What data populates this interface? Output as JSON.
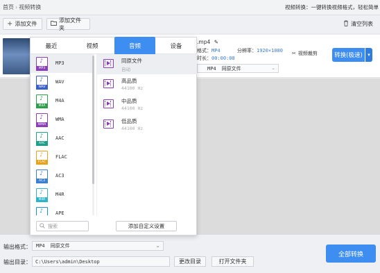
{
  "topbar": {
    "breadcrumb_home": "首页",
    "breadcrumb_sep": "›",
    "breadcrumb_current": "视频转换",
    "tagline": "视频转换：一键转换视频格式，轻松简单"
  },
  "toolbar": {
    "add_file": "添加文件",
    "add_folder": "添加文件夹",
    "clear_list": "清空列表"
  },
  "file": {
    "name": ".mp4",
    "format_label": "格式：",
    "format_value": "MP4",
    "duration_label": "时长：",
    "duration_value": "00:00:08",
    "resolution_label": "分辨率：",
    "resolution_value": "1920×1080",
    "output_format": "MP4",
    "output_quality": "同原文件",
    "clip_label": "视频裁剪",
    "convert_label": "转换(极速)"
  },
  "popup": {
    "tabs": [
      "最近",
      "视频",
      "音频",
      "设备"
    ],
    "active_tab": "音频",
    "formats": [
      {
        "name": "MP3",
        "color": "#8a3fb5"
      },
      {
        "name": "WAV",
        "color": "#3a5fc8"
      },
      {
        "name": "M4A",
        "color": "#2e9e4d"
      },
      {
        "name": "WMA",
        "color": "#8a3fb5"
      },
      {
        "name": "AAC",
        "color": "#1f9e8a"
      },
      {
        "name": "FLAC",
        "color": "#e6a21a"
      },
      {
        "name": "AC3",
        "color": "#3a7fd0"
      },
      {
        "name": "M4R",
        "color": "#2fb3c8"
      },
      {
        "name": "APE",
        "color": "#1e8fd6"
      }
    ],
    "qualities": [
      {
        "name": "同原文件",
        "sub": "自动"
      },
      {
        "name": "高品质",
        "sub": "44100 Hz"
      },
      {
        "name": "中品质",
        "sub": "44100 Hz"
      },
      {
        "name": "低品质",
        "sub": "44100 Hz"
      }
    ],
    "search_placeholder": "搜索",
    "custom_button": "添加自定义设置"
  },
  "bottom": {
    "output_format_label": "输出格式：",
    "output_format_value": "MP4",
    "output_format_quality": "同原文件",
    "output_dir_label": "输出目录：",
    "output_dir_value": "C:\\Users\\admin\\Desktop",
    "change_dir": "更改目录",
    "open_folder": "打开文件夹",
    "convert_all": "全部转换"
  }
}
